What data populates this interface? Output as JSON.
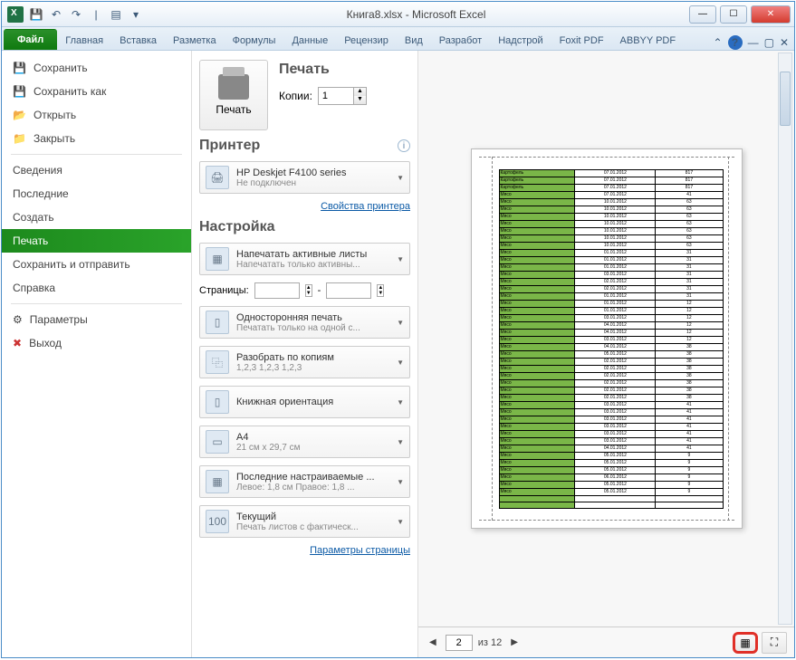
{
  "window": {
    "title": "Книга8.xlsx - Microsoft Excel"
  },
  "ribbon": {
    "file": "Файл",
    "tabs": [
      "Главная",
      "Вставка",
      "Разметка",
      "Формулы",
      "Данные",
      "Рецензир",
      "Вид",
      "Разработ",
      "Надстрой",
      "Foxit PDF",
      "ABBYY PDF"
    ]
  },
  "sidebar": {
    "save": "Сохранить",
    "save_as": "Сохранить как",
    "open": "Открыть",
    "close": "Закрыть",
    "info": "Сведения",
    "recent": "Последние",
    "new": "Создать",
    "print": "Печать",
    "save_send": "Сохранить и отправить",
    "help": "Справка",
    "options": "Параметры",
    "exit": "Выход"
  },
  "print": {
    "header": "Печать",
    "button": "Печать",
    "copies_label": "Копии:",
    "copies_value": "1",
    "printer_header": "Принтер",
    "printer_name": "HP Deskjet F4100 series",
    "printer_status": "Не подключен",
    "printer_props": "Свойства принтера",
    "settings_header": "Настройка",
    "print_active": "Напечатать активные листы",
    "print_active_sub": "Напечатать только активны...",
    "pages_label": "Страницы:",
    "pages_sep": "-",
    "one_sided": "Односторонняя печать",
    "one_sided_sub": "Печатать только на одной с...",
    "collate": "Разобрать по копиям",
    "collate_sub": "1,2,3   1,2,3   1,2,3",
    "orientation": "Книжная ориентация",
    "paper": "A4",
    "paper_sub": "21 см x 29,7 см",
    "margins": "Последние настраиваемые ...",
    "margins_sub": "Левое: 1,8 см   Правое: 1,8 ...",
    "scaling": "Текущий",
    "scaling_sub": "Печать листов с фактическ...",
    "page_setup": "Параметры страницы"
  },
  "preview": {
    "rows": [
      {
        "a": "Картофель",
        "b": "07.01.2012",
        "c": "817"
      },
      {
        "a": "Картофель",
        "b": "07.01.2012",
        "c": "817"
      },
      {
        "a": "Картофель",
        "b": "07.01.2012",
        "c": "817"
      },
      {
        "a": "Мясо",
        "b": "07.01.2012",
        "c": "41"
      },
      {
        "a": "Мясо",
        "b": "10.01.2012",
        "c": "63"
      },
      {
        "a": "Мясо",
        "b": "10.01.2012",
        "c": "63"
      },
      {
        "a": "Мясо",
        "b": "10.01.2012",
        "c": "63"
      },
      {
        "a": "Мясо",
        "b": "10.01.2012",
        "c": "63"
      },
      {
        "a": "Мясо",
        "b": "10.01.2012",
        "c": "63"
      },
      {
        "a": "Мясо",
        "b": "10.01.2012",
        "c": "63"
      },
      {
        "a": "Мясо",
        "b": "10.01.2012",
        "c": "63"
      },
      {
        "a": "Мясо",
        "b": "01.01.2012",
        "c": "31"
      },
      {
        "a": "Мясо",
        "b": "01.01.2012",
        "c": "31"
      },
      {
        "a": "Мясо",
        "b": "01.01.2012",
        "c": "31"
      },
      {
        "a": "Мясо",
        "b": "03.01.2012",
        "c": "31"
      },
      {
        "a": "Мясо",
        "b": "02.01.2012",
        "c": "31"
      },
      {
        "a": "Мясо",
        "b": "02.01.2012",
        "c": "31"
      },
      {
        "a": "Мясо",
        "b": "01.01.2012",
        "c": "31"
      },
      {
        "a": "Мясо",
        "b": "01.01.2012",
        "c": "12"
      },
      {
        "a": "Мясо",
        "b": "01.01.2012",
        "c": "12"
      },
      {
        "a": "Мясо",
        "b": "03.01.2012",
        "c": "12"
      },
      {
        "a": "Мясо",
        "b": "04.01.2012",
        "c": "12"
      },
      {
        "a": "Мясо",
        "b": "04.01.2012",
        "c": "12"
      },
      {
        "a": "Мясо",
        "b": "03.01.2012",
        "c": "12"
      },
      {
        "a": "Мясо",
        "b": "04.01.2012",
        "c": "38"
      },
      {
        "a": "Мясо",
        "b": "05.01.2012",
        "c": "38"
      },
      {
        "a": "Мясо",
        "b": "02.01.2012",
        "c": "38"
      },
      {
        "a": "Мясо",
        "b": "02.01.2012",
        "c": "38"
      },
      {
        "a": "Мясо",
        "b": "02.01.2012",
        "c": "38"
      },
      {
        "a": "Мясо",
        "b": "02.01.2012",
        "c": "38"
      },
      {
        "a": "Мясо",
        "b": "02.01.2012",
        "c": "38"
      },
      {
        "a": "Мясо",
        "b": "02.01.2012",
        "c": "38"
      },
      {
        "a": "Мясо",
        "b": "03.01.2012",
        "c": "41"
      },
      {
        "a": "Мясо",
        "b": "03.01.2012",
        "c": "41"
      },
      {
        "a": "Мясо",
        "b": "03.01.2012",
        "c": "41"
      },
      {
        "a": "Мясо",
        "b": "03.01.2012",
        "c": "41"
      },
      {
        "a": "Мясо",
        "b": "03.01.2012",
        "c": "41"
      },
      {
        "a": "Мясо",
        "b": "03.01.2012",
        "c": "41"
      },
      {
        "a": "Мясо",
        "b": "04.01.2012",
        "c": "41"
      },
      {
        "a": "Мясо",
        "b": "05.01.2012",
        "c": "9"
      },
      {
        "a": "Мясо",
        "b": "05.01.2012",
        "c": "9"
      },
      {
        "a": "Мясо",
        "b": "05.01.2012",
        "c": "9"
      },
      {
        "a": "Мясо",
        "b": "06.01.2012",
        "c": "9"
      },
      {
        "a": "Мясо",
        "b": "05.01.2012",
        "c": "9"
      },
      {
        "a": "Мясо",
        "b": "05.01.2012",
        "c": "9"
      },
      {
        "a": "",
        "b": "",
        "c": ""
      },
      {
        "a": "",
        "b": "",
        "c": ""
      }
    ],
    "page_current": "2",
    "page_of_label": "из 12"
  }
}
